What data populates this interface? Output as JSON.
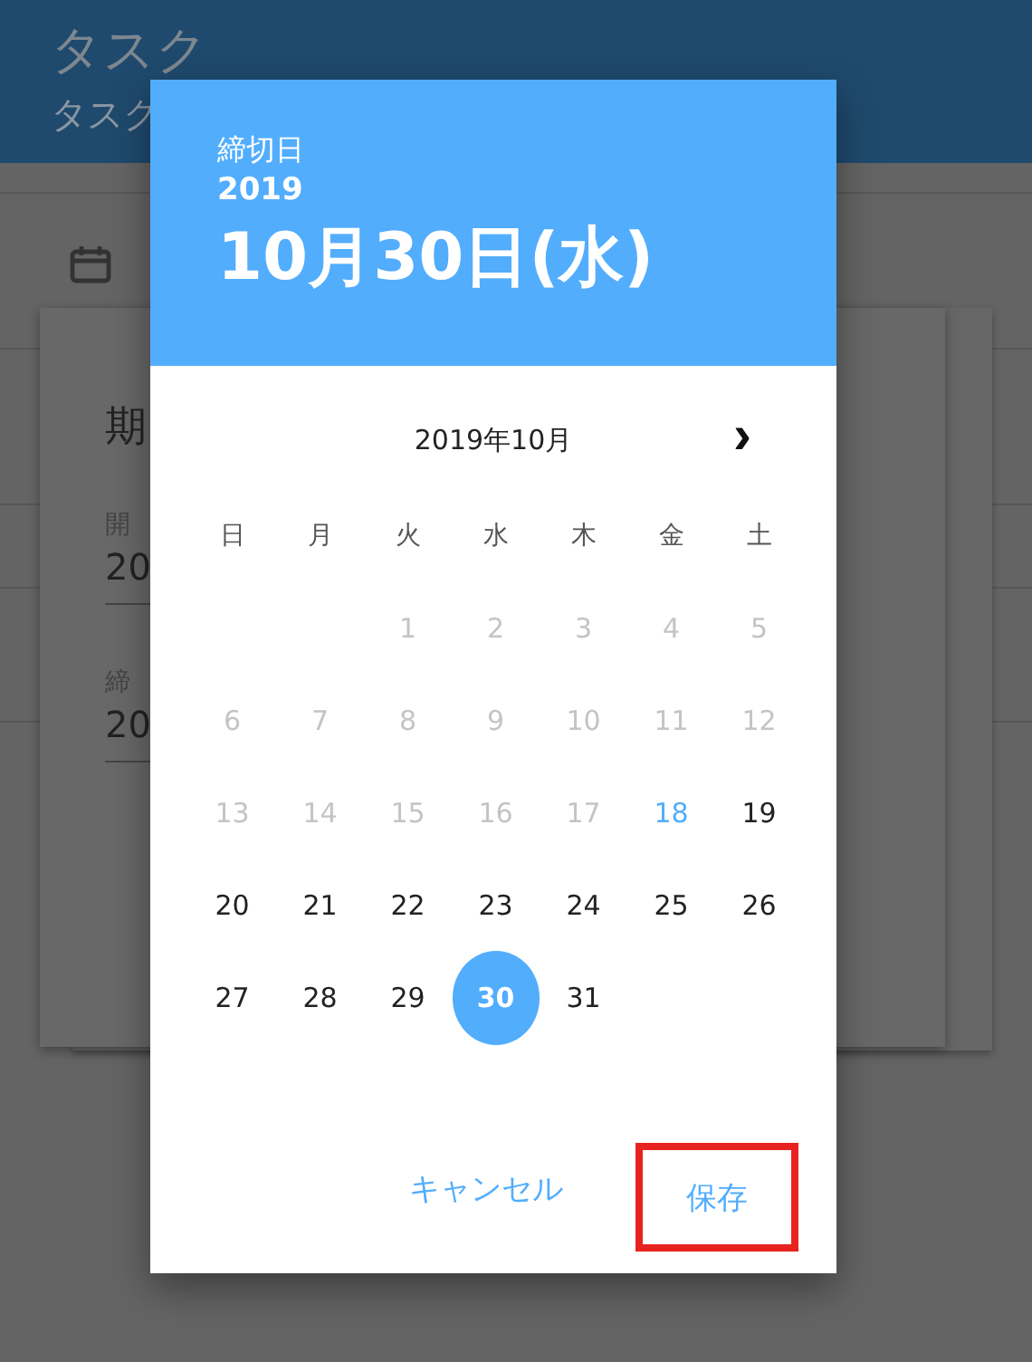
{
  "app_bar": {
    "title": "タスク",
    "subtitle": "タスク"
  },
  "card": {
    "heading": "期",
    "fields": [
      {
        "label": "開",
        "value": "20"
      },
      {
        "label": "締",
        "value": "20"
      }
    ]
  },
  "dialog": {
    "caption": "締切日",
    "year": "2019",
    "date": "10月30日(水)",
    "month_title": "2019年10月",
    "next": "›",
    "weekdays": [
      "日",
      "月",
      "火",
      "水",
      "木",
      "金",
      "土"
    ],
    "weeks": [
      [
        {
          "kind": "blank"
        },
        {
          "kind": "blank"
        },
        {
          "kind": "day",
          "label": "1",
          "disabled": true,
          "today": false,
          "selected": false
        },
        {
          "kind": "day",
          "label": "2",
          "disabled": true,
          "today": false,
          "selected": false
        },
        {
          "kind": "day",
          "label": "3",
          "disabled": true,
          "today": false,
          "selected": false
        },
        {
          "kind": "day",
          "label": "4",
          "disabled": true,
          "today": false,
          "selected": false
        },
        {
          "kind": "day",
          "label": "5",
          "disabled": true,
          "today": false,
          "selected": false
        }
      ],
      [
        {
          "kind": "day",
          "label": "6",
          "disabled": true,
          "today": false,
          "selected": false
        },
        {
          "kind": "day",
          "label": "7",
          "disabled": true,
          "today": false,
          "selected": false
        },
        {
          "kind": "day",
          "label": "8",
          "disabled": true,
          "today": false,
          "selected": false
        },
        {
          "kind": "day",
          "label": "9",
          "disabled": true,
          "today": false,
          "selected": false
        },
        {
          "kind": "day",
          "label": "10",
          "disabled": true,
          "today": false,
          "selected": false
        },
        {
          "kind": "day",
          "label": "11",
          "disabled": true,
          "today": false,
          "selected": false
        },
        {
          "kind": "day",
          "label": "12",
          "disabled": true,
          "today": false,
          "selected": false
        }
      ],
      [
        {
          "kind": "day",
          "label": "13",
          "disabled": true,
          "today": false,
          "selected": false
        },
        {
          "kind": "day",
          "label": "14",
          "disabled": true,
          "today": false,
          "selected": false
        },
        {
          "kind": "day",
          "label": "15",
          "disabled": true,
          "today": false,
          "selected": false
        },
        {
          "kind": "day",
          "label": "16",
          "disabled": true,
          "today": false,
          "selected": false
        },
        {
          "kind": "day",
          "label": "17",
          "disabled": true,
          "today": false,
          "selected": false
        },
        {
          "kind": "day",
          "label": "18",
          "disabled": false,
          "today": true,
          "selected": false
        },
        {
          "kind": "day",
          "label": "19",
          "disabled": false,
          "today": false,
          "selected": false
        }
      ],
      [
        {
          "kind": "day",
          "label": "20",
          "disabled": false,
          "today": false,
          "selected": false
        },
        {
          "kind": "day",
          "label": "21",
          "disabled": false,
          "today": false,
          "selected": false
        },
        {
          "kind": "day",
          "label": "22",
          "disabled": false,
          "today": false,
          "selected": false
        },
        {
          "kind": "day",
          "label": "23",
          "disabled": false,
          "today": false,
          "selected": false
        },
        {
          "kind": "day",
          "label": "24",
          "disabled": false,
          "today": false,
          "selected": false
        },
        {
          "kind": "day",
          "label": "25",
          "disabled": false,
          "today": false,
          "selected": false
        },
        {
          "kind": "day",
          "label": "26",
          "disabled": false,
          "today": false,
          "selected": false
        }
      ],
      [
        {
          "kind": "day",
          "label": "27",
          "disabled": false,
          "today": false,
          "selected": false
        },
        {
          "kind": "day",
          "label": "28",
          "disabled": false,
          "today": false,
          "selected": false
        },
        {
          "kind": "day",
          "label": "29",
          "disabled": false,
          "today": false,
          "selected": false
        },
        {
          "kind": "day",
          "label": "30",
          "disabled": false,
          "today": false,
          "selected": true
        },
        {
          "kind": "day",
          "label": "31",
          "disabled": false,
          "today": false,
          "selected": false
        }
      ]
    ],
    "buttons": [
      {
        "label": "キャンセル",
        "highlighted": false
      },
      {
        "label": "保存",
        "highlighted": true
      }
    ]
  }
}
